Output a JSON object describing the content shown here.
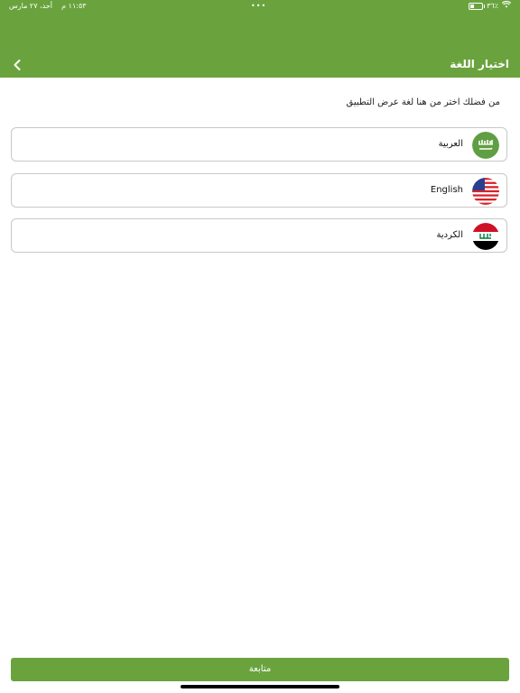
{
  "status_bar": {
    "time": "١١:٥٣ م",
    "date": "أحد، ٢٧ مارس",
    "battery": "٣٦٪",
    "battery_level": 0.36
  },
  "header": {
    "title": "اختيار اللغة"
  },
  "subtitle": "من فضلك اختر من هنا لغة عرض التطبيق",
  "languages": [
    {
      "label": "العربية",
      "flag": "saudi-arabia-flag"
    },
    {
      "label": "English",
      "flag": "usa-flag"
    },
    {
      "label": "الكردية",
      "flag": "iraq-flag"
    }
  ],
  "continue_label": "متابعة",
  "colors": {
    "primary": "#6aa33e",
    "border": "#c8c8c8"
  }
}
